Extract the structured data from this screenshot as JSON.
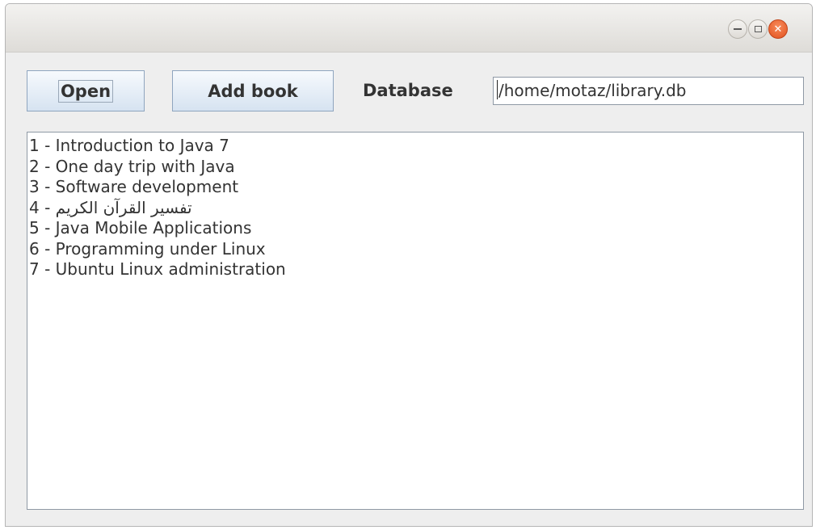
{
  "window": {
    "controls": {
      "minimize_icon": "minimize-icon",
      "maximize_icon": "maximize-icon",
      "close_icon": "close-icon",
      "close_color": "#e95420"
    }
  },
  "toolbar": {
    "open_label": "Open",
    "add_book_label": "Add book",
    "database_label": "Database",
    "database_value": "/home/motaz/library.db"
  },
  "books": [
    "1 - Introduction to Java 7",
    "2 - One day trip with Java",
    "3 - Software development",
    "4 - تفسير القرآن الكريم",
    "5 - Java Mobile Applications",
    "6 - Programming under Linux",
    "7 - Ubuntu Linux administration"
  ]
}
